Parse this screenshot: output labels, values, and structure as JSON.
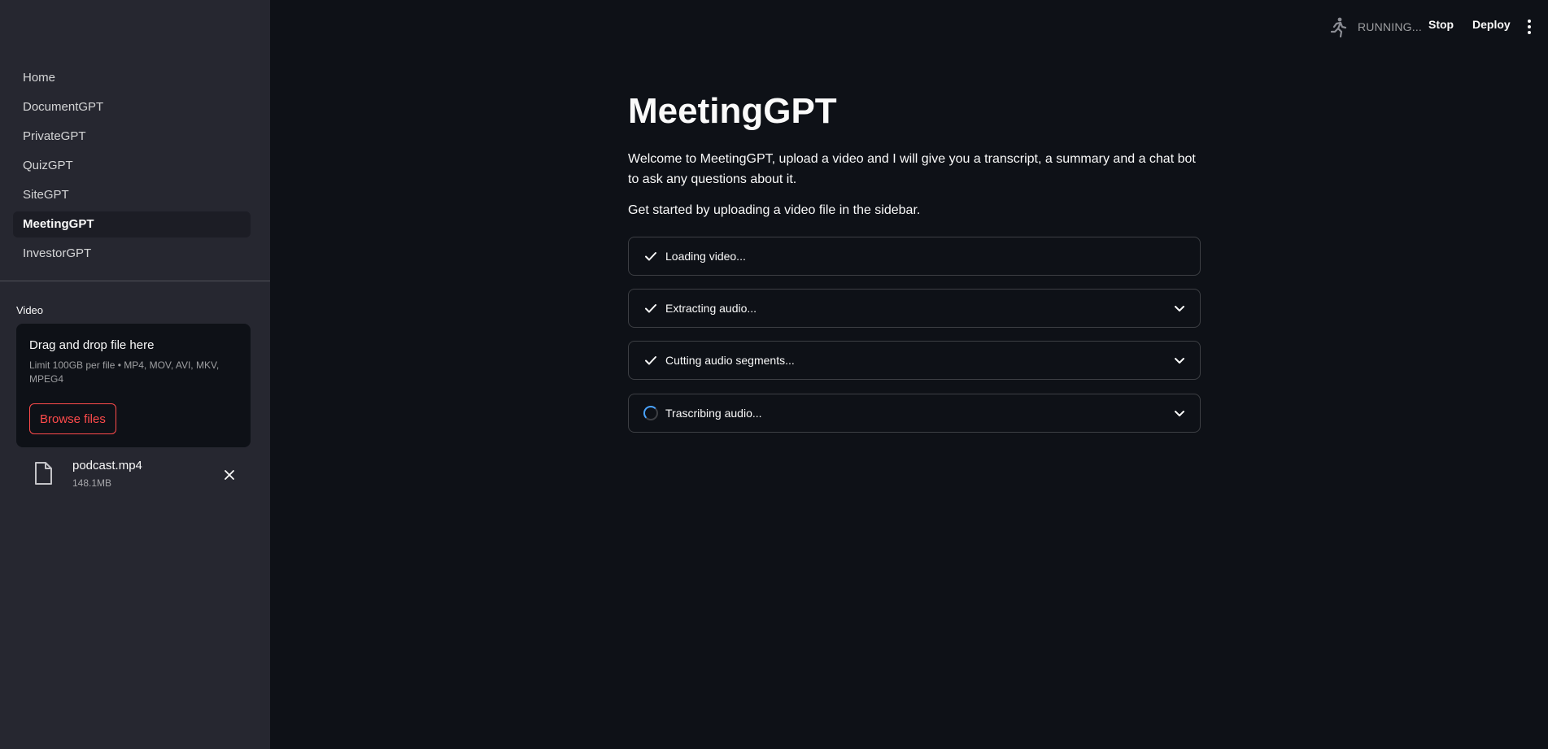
{
  "sidebar": {
    "nav": [
      {
        "label": "Home",
        "active": false
      },
      {
        "label": "DocumentGPT",
        "active": false
      },
      {
        "label": "PrivateGPT",
        "active": false
      },
      {
        "label": "QuizGPT",
        "active": false
      },
      {
        "label": "SiteGPT",
        "active": false
      },
      {
        "label": "MeetingGPT",
        "active": true
      },
      {
        "label": "InvestorGPT",
        "active": false
      }
    ],
    "uploader": {
      "label": "Video",
      "dropzone_title": "Drag and drop file here",
      "limit_text": "Limit 100GB per file • MP4, MOV, AVI, MKV, MPEG4",
      "browse_label": "Browse files",
      "file": {
        "name": "podcast.mp4",
        "size": "148.1MB",
        "icon": "file-icon"
      }
    }
  },
  "header": {
    "status_text": "RUNNING...",
    "stop_label": "Stop",
    "deploy_label": "Deploy"
  },
  "main": {
    "title": "MeetingGPT",
    "intro": "Welcome to MeetingGPT, upload a video and I will give you a transcript, a summary and a chat bot to ask any questions about it.",
    "intro2": "Get started by uploading a video file in the sidebar.",
    "statuses": [
      {
        "label": "Loading video...",
        "state": "complete",
        "expandable": false
      },
      {
        "label": "Extracting audio...",
        "state": "complete",
        "expandable": true
      },
      {
        "label": "Cutting audio segments...",
        "state": "complete",
        "expandable": true
      },
      {
        "label": "Trascribing audio...",
        "state": "running",
        "expandable": true
      }
    ]
  },
  "colors": {
    "background": "#0e1117",
    "sidebar": "#262730",
    "accent": "#ff4b4b",
    "spinner": "#4aa3ff"
  }
}
